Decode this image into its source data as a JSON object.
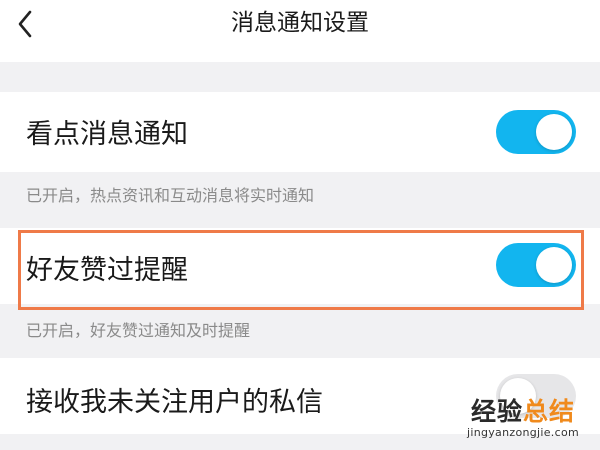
{
  "header": {
    "back_icon": "chevron-left-icon",
    "title": "消息通知设置"
  },
  "settings": [
    {
      "label": "看点消息通知",
      "hint": "已开启，热点资讯和互动消息将实时通知",
      "toggle_on": true
    },
    {
      "label": "好友赞过提醒",
      "hint": "已开启，好友赞过通知及时提醒",
      "toggle_on": true,
      "highlighted": true
    },
    {
      "label": "接收我未关注用户的私信",
      "toggle_on": false
    }
  ],
  "colors": {
    "toggle_on": "#12b5ef",
    "toggle_off": "#e6e6e8",
    "highlight_border": "#ef7a48",
    "page_background": "#f1f1f3"
  },
  "watermark": {
    "main_a": "经验",
    "main_b": "总结",
    "sub": "jingyanzongjie.com"
  }
}
